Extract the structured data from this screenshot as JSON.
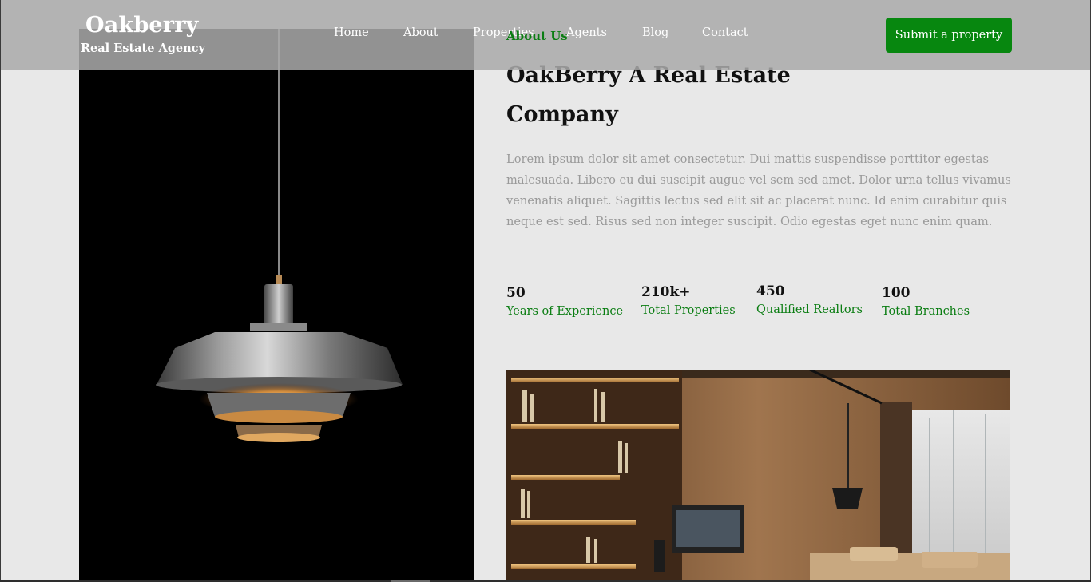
{
  "header": {
    "logo_title": "Oakberry",
    "logo_subtitle": "Real Estate Agency",
    "nav": [
      "Home",
      "About",
      "Properties",
      "Agents",
      "Blog",
      "Contact"
    ],
    "cta_label": "Submit a property"
  },
  "about": {
    "eyebrow": "About Us",
    "heading": "OakBerry A Real Estate Company",
    "body": "Lorem ipsum dolor sit amet consectetur. Dui mattis suspendisse porttitor egestas malesuada. Libero eu dui suscipit augue vel sem sed amet. Dolor urna tellus vivamus venenatis aliquet. Sagittis lectus sed elit sit ac placerat nunc. Id enim curabitur quis neque est sed. Risus sed non integer suscipit. Odio egestas eget nunc enim quam.",
    "stats": [
      {
        "value": "50",
        "label": "Years of Experience"
      },
      {
        "value": "210k+",
        "label": "Total Properties"
      },
      {
        "value": "450",
        "label": "Qualified Realtors"
      },
      {
        "value": "100",
        "label": "Total Branches"
      }
    ]
  },
  "images": {
    "left": "pendant-lamp-photo",
    "bottom": "living-room-interior-photo"
  },
  "colors": {
    "accent_green": "#07870f",
    "header_overlay": "#aaaaaa",
    "page_bg": "#e8e8e8"
  }
}
